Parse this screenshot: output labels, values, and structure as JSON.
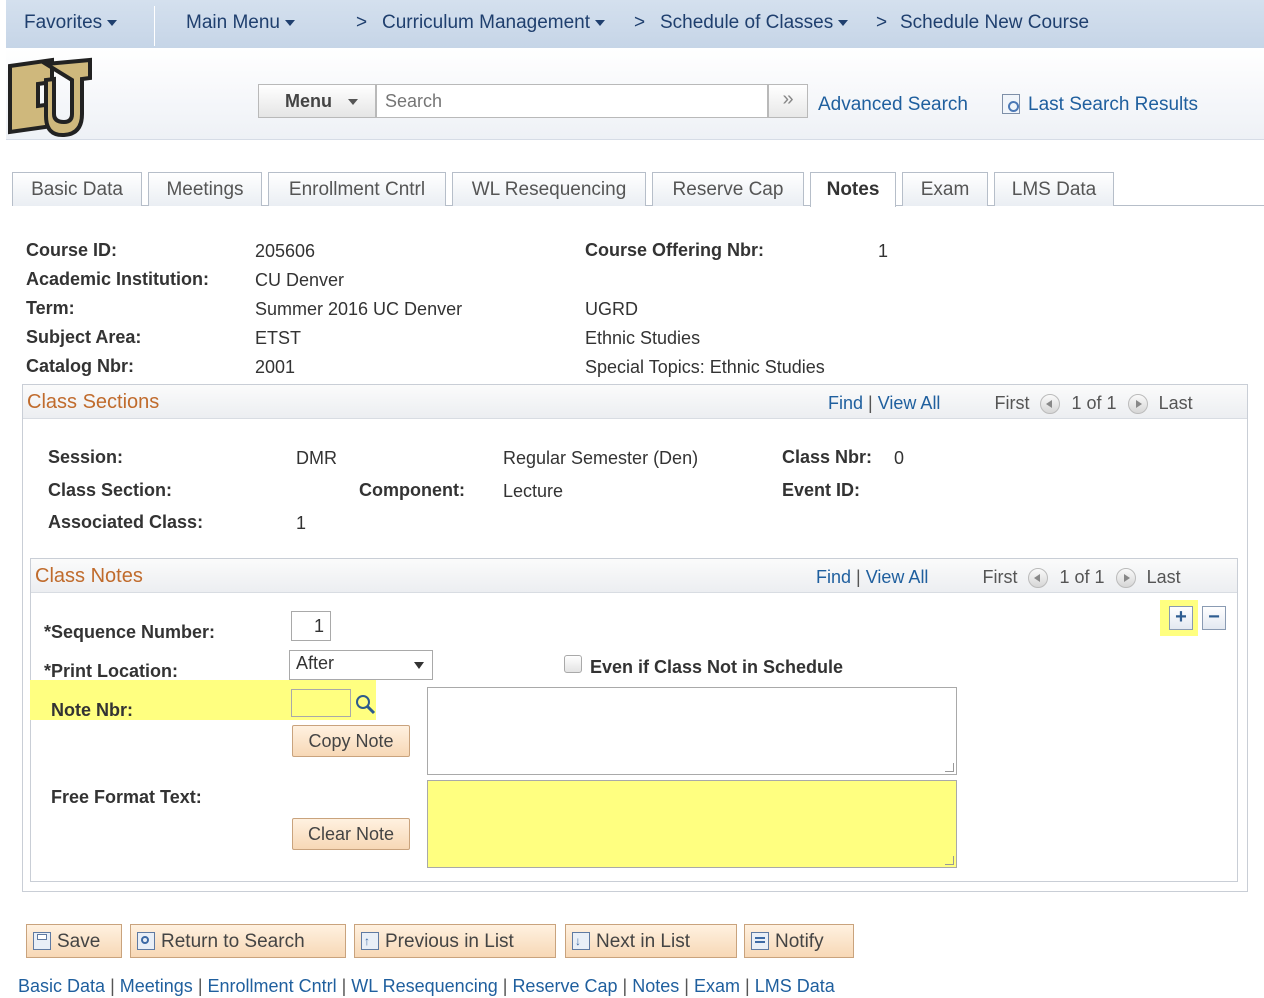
{
  "topnav": {
    "favorites": "Favorites",
    "main_menu": "Main Menu",
    "crumb_sep": ">",
    "crumbs": [
      "Curriculum Management",
      "Schedule of Classes",
      "Schedule New Course"
    ]
  },
  "header": {
    "logo_text": "CU",
    "menu_label": "Menu",
    "search_placeholder": "Search",
    "search_go": "»",
    "advanced_search": "Advanced Search",
    "last_search_results": "Last Search Results"
  },
  "tabs": [
    "Basic Data",
    "Meetings",
    "Enrollment Cntrl",
    "WL Resequencing",
    "Reserve Cap",
    "Notes",
    "Exam",
    "LMS Data"
  ],
  "active_tab": "Notes",
  "course": {
    "course_id_label": "Course ID:",
    "course_id": "205606",
    "offering_label": "Course Offering Nbr:",
    "offering": "1",
    "institution_label": "Academic Institution:",
    "institution": "CU Denver",
    "term_label": "Term:",
    "term": "Summer 2016 UC Denver",
    "career": "UGRD",
    "subject_label": "Subject Area:",
    "subject": "ETST",
    "subject_desc": "Ethnic Studies",
    "catalog_label": "Catalog Nbr:",
    "catalog": "2001",
    "catalog_desc": "Special Topics: Ethnic Studies"
  },
  "class_sections": {
    "title": "Class Sections",
    "find": "Find",
    "bar": "|",
    "view_all": "View All",
    "first": "First",
    "count": "1 of 1",
    "last": "Last",
    "session_label": "Session:",
    "session": "DMR",
    "session_desc": "Regular Semester (Den)",
    "class_nbr_label": "Class Nbr:",
    "class_nbr": "0",
    "section_label": "Class Section:",
    "component_label": "Component:",
    "component": "Lecture",
    "event_label": "Event ID:",
    "assoc_label": "Associated Class:",
    "assoc": "1"
  },
  "class_notes": {
    "title": "Class Notes",
    "find": "Find",
    "bar": "|",
    "view_all": "View All",
    "first": "First",
    "count": "1 of 1",
    "last": "Last",
    "add": "+",
    "remove": "−",
    "seq_label": "*Sequence Number:",
    "seq": "1",
    "print_label": "*Print Location:",
    "print_value": "After",
    "even_if_label": "Even if Class Not in Schedule",
    "note_nbr_label": "Note Nbr:",
    "note_nbr": "",
    "copy_note": "Copy Note",
    "free_text_label": "Free Format Text:",
    "clear_note": "Clear Note"
  },
  "toolbar": {
    "save": "Save",
    "return_to_search": "Return to Search",
    "previous_in_list": "Previous in List",
    "next_in_list": "Next in List",
    "notify": "Notify"
  },
  "footer_links": [
    "Basic Data",
    "Meetings",
    "Enrollment Cntrl",
    "WL Resequencing",
    "Reserve Cap",
    "Notes",
    "Exam",
    "LMS Data"
  ],
  "footer_sep": "|",
  "colors": {
    "highlight": "#ffff80",
    "link": "#1f5f9e",
    "group_title": "#c06b2c"
  }
}
